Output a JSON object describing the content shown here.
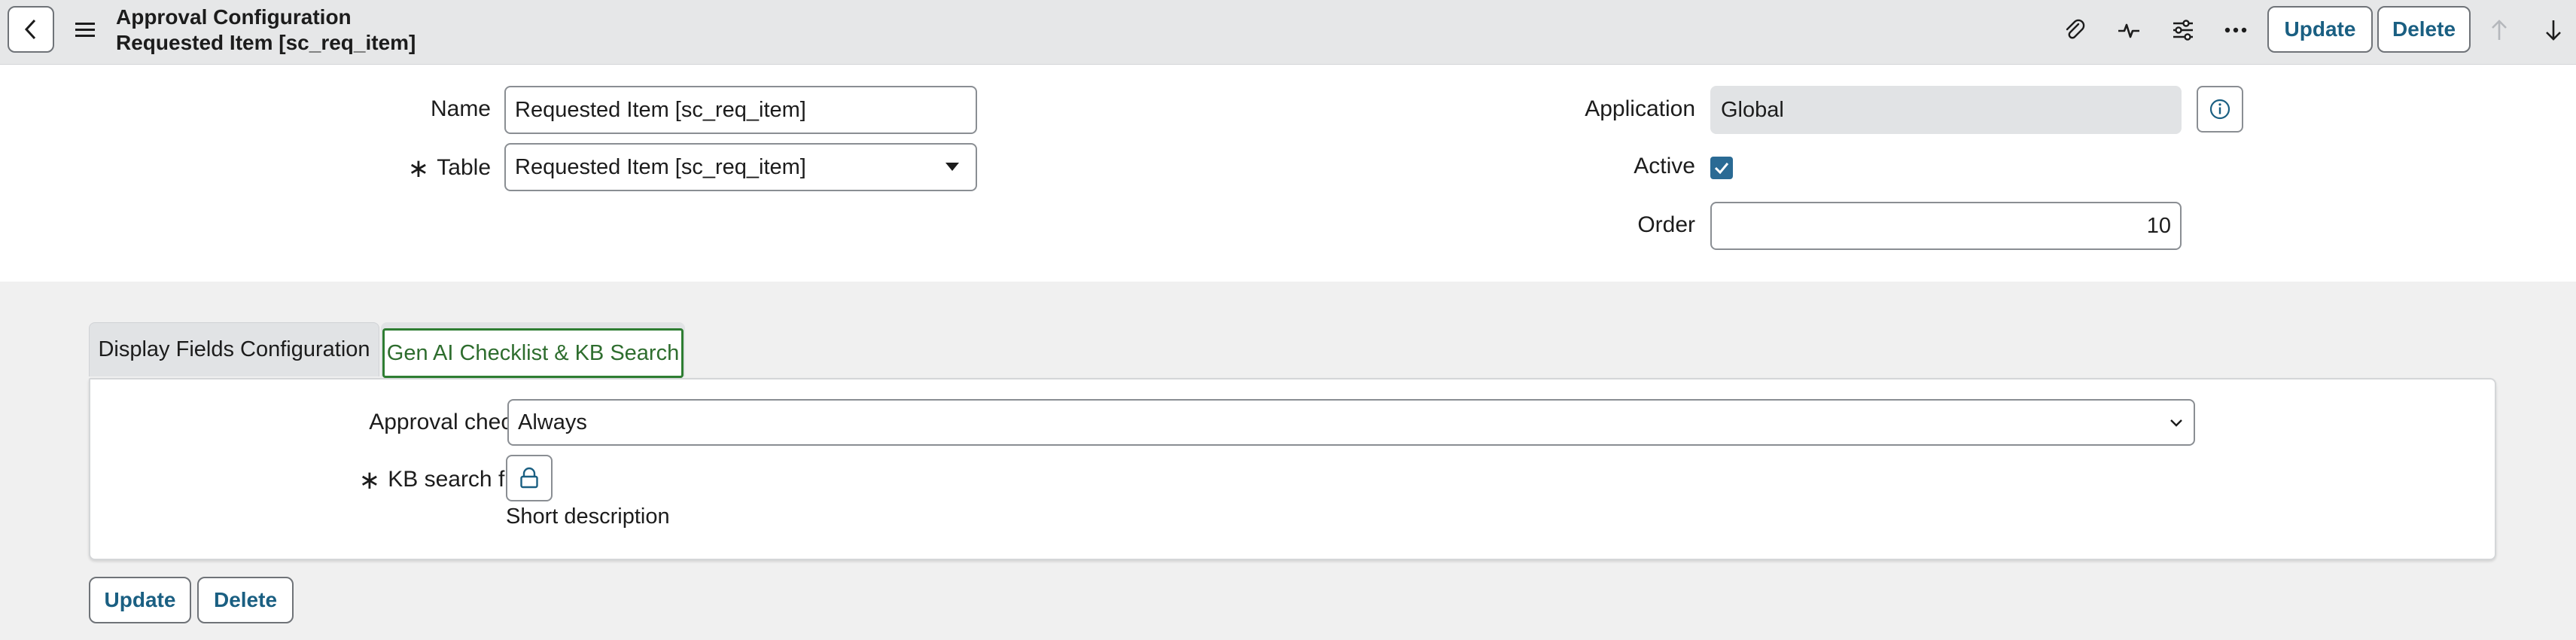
{
  "header": {
    "title_line1": "Approval Configuration",
    "title_line2": "Requested Item [sc_req_item]",
    "icons": [
      "back-icon",
      "menu-icon",
      "paperclip-icon",
      "activity-icon",
      "sliders-icon",
      "more-icon",
      "arrow-up-icon",
      "arrow-down-icon"
    ],
    "update_label": "Update",
    "delete_label": "Delete"
  },
  "form": {
    "name_label": "Name",
    "name_value": "Requested Item [sc_req_item]",
    "table_required": "∗",
    "table_label": "Table",
    "table_value": "Requested Item [sc_req_item]",
    "application_label": "Application",
    "application_value": "Global",
    "active_label": "Active",
    "active_checked": true,
    "order_label": "Order",
    "order_value": "10"
  },
  "tabs": {
    "items": [
      "Display Fields Configuration",
      "Gen AI Checklist & KB Search"
    ],
    "active": "Gen AI Checklist & KB Search"
  },
  "panel": {
    "approval_checklist_label": "Approval checklist",
    "approval_checklist_value": "Always",
    "kb_required": "∗",
    "kb_label": "KB search fields",
    "kb_value": "Short description"
  },
  "footer": {
    "update_label": "Update",
    "delete_label": "Delete"
  },
  "colors": {
    "accent": "#1a5f82",
    "checkbox": "#2a6a94",
    "active_tab_border": "#2e7d32",
    "header_bg": "#e6e7e8"
  }
}
